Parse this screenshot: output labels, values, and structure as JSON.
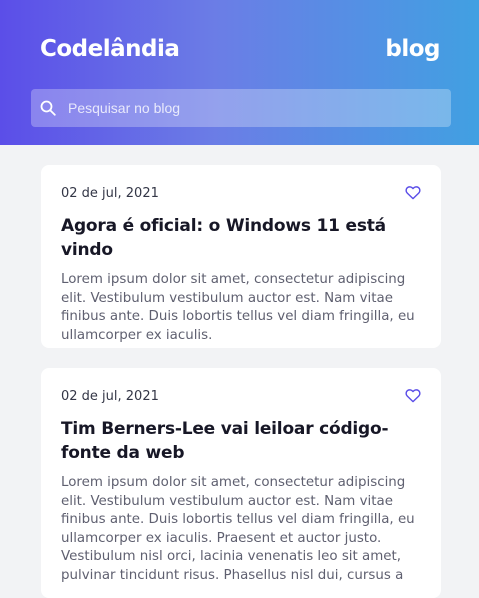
{
  "header": {
    "brand": "Codelândia",
    "section": "blog",
    "search": {
      "placeholder": "Pesquisar no blog",
      "icon": "search-icon"
    }
  },
  "colors": {
    "gradient_start": "#5b4ee8",
    "gradient_end": "#41a0e2",
    "heart": "#5b4ee8",
    "background": "#f2f3f5"
  },
  "posts": [
    {
      "date": "02 de jul, 2021",
      "title": "Agora é oficial: o Windows 11 está vindo",
      "body": "Lorem ipsum dolor sit amet, consectetur adipiscing elit. Vestibulum vestibulum auctor est. Nam vitae finibus ante. Duis lobortis tellus vel diam fringilla, eu ullamcorper ex iaculis.",
      "icon": "heart-icon"
    },
    {
      "date": "02 de jul, 2021",
      "title": "Tim Berners-Lee vai leiloar código-fonte da web",
      "body": "Lorem ipsum dolor sit amet, consectetur adipiscing elit. Vestibulum vestibulum auctor est. Nam vitae finibus ante. Duis lobortis tellus vel diam fringilla, eu ullamcorper ex iaculis. Praesent et auctor justo. Vestibulum nisl orci, lacinia venenatis leo sit amet, pulvinar tincidunt risus. Phasellus nisl dui, cursus a",
      "icon": "heart-icon"
    }
  ]
}
